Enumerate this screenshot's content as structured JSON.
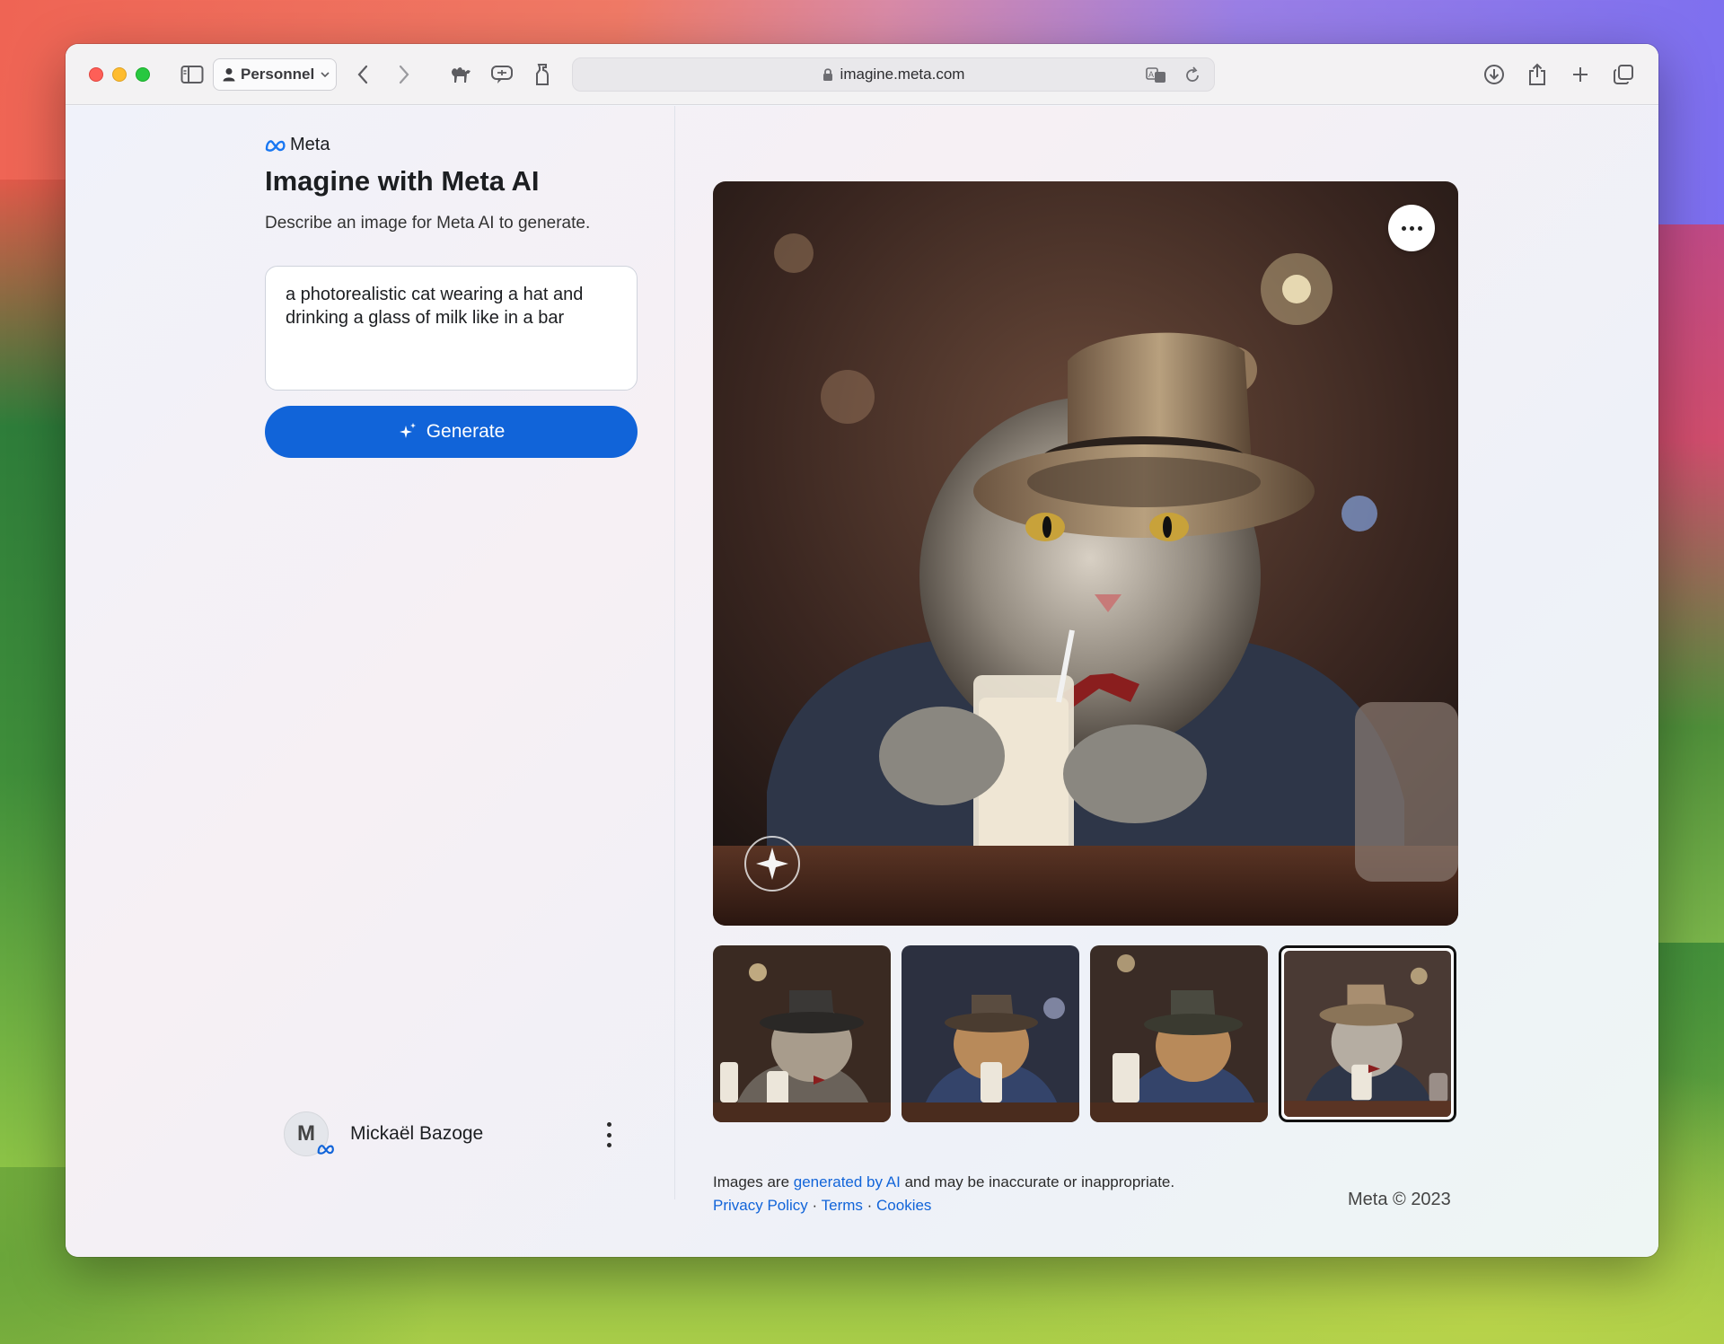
{
  "browser": {
    "profile_label": "Personnel",
    "url": "imagine.meta.com"
  },
  "sidebar": {
    "brand": "Meta",
    "title": "Imagine with Meta AI",
    "subtitle": "Describe an image for Meta AI to generate.",
    "prompt_text": "a photorealistic cat wearing a hat and drinking a glass of milk like in a bar",
    "generate_label": "Generate"
  },
  "user": {
    "initial": "M",
    "name": "Mickaël Bazoge"
  },
  "footer": {
    "disclaimer_prefix": "Images are ",
    "disclaimer_link": "generated by AI",
    "disclaimer_suffix": " and may be inaccurate or inappropriate.",
    "privacy": "Privacy Policy",
    "sep1": " · ",
    "terms": "Terms",
    "sep2": " · ",
    "cookies": "Cookies",
    "copyright": "Meta © 2023"
  },
  "colors": {
    "accent": "#1164d9"
  },
  "icons": {
    "sidebar": "sidebar-icon",
    "back": "chevron-left-icon",
    "forward": "chevron-right-icon",
    "lock": "lock-icon",
    "download": "download-icon",
    "share": "share-icon",
    "new_tab": "plus-icon",
    "tabs": "tabs-overview-icon"
  }
}
